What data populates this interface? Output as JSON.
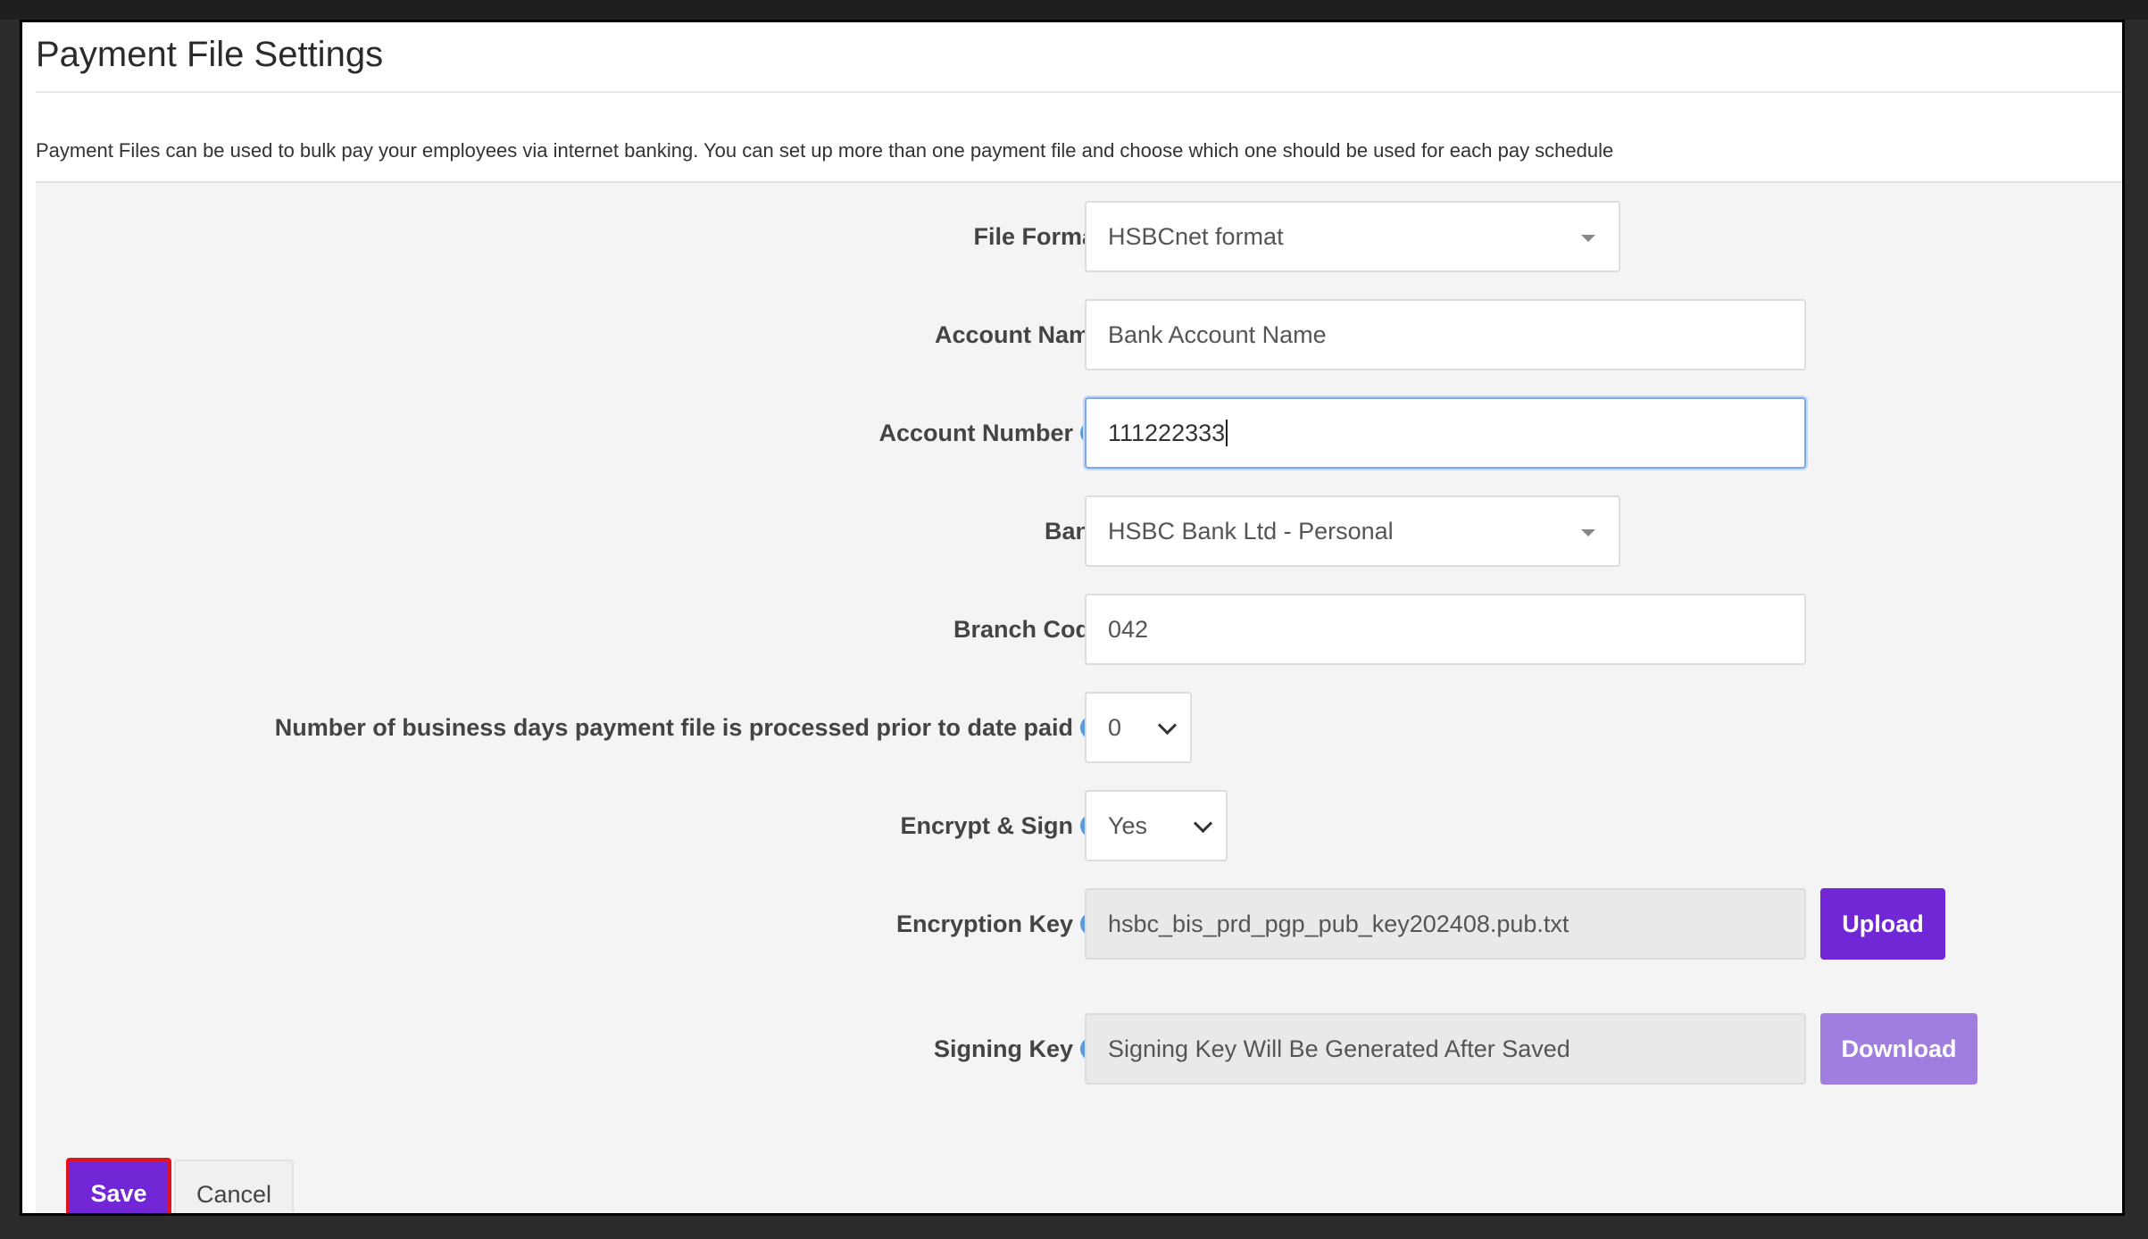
{
  "title": "Payment File Settings",
  "description": "Payment Files can be used to bulk pay your employees via internet banking. You can set up more than one payment file and choose which one should be used for each pay schedule",
  "fields": {
    "file_format": {
      "label": "File Format",
      "value": "HSBCnet format"
    },
    "account_name": {
      "label": "Account Name",
      "placeholder": "Bank Account Name"
    },
    "account_number": {
      "label": "Account Number",
      "value": "111222333"
    },
    "bank": {
      "label": "Bank",
      "value": "HSBC Bank Ltd - Personal"
    },
    "branch_code": {
      "label": "Branch Code",
      "value": "042"
    },
    "business_days": {
      "label": "Number of business days payment file is processed prior to date paid",
      "value": "0"
    },
    "encrypt_sign": {
      "label": "Encrypt & Sign",
      "value": "Yes"
    },
    "encryption_key": {
      "label": "Encryption Key",
      "value": "hsbc_bis_prd_pgp_pub_key202408.pub.txt",
      "button": "Upload"
    },
    "signing_key": {
      "label": "Signing Key",
      "value": "Signing Key Will Be Generated After Saved",
      "button": "Download"
    }
  },
  "help_glyph": "?",
  "actions": {
    "save": "Save",
    "cancel": "Cancel"
  },
  "colors": {
    "primary": "#7227d6",
    "primary_disabled": "#a07ee0",
    "help_icon": "#5b9bdb",
    "highlight": "#e0131f"
  }
}
